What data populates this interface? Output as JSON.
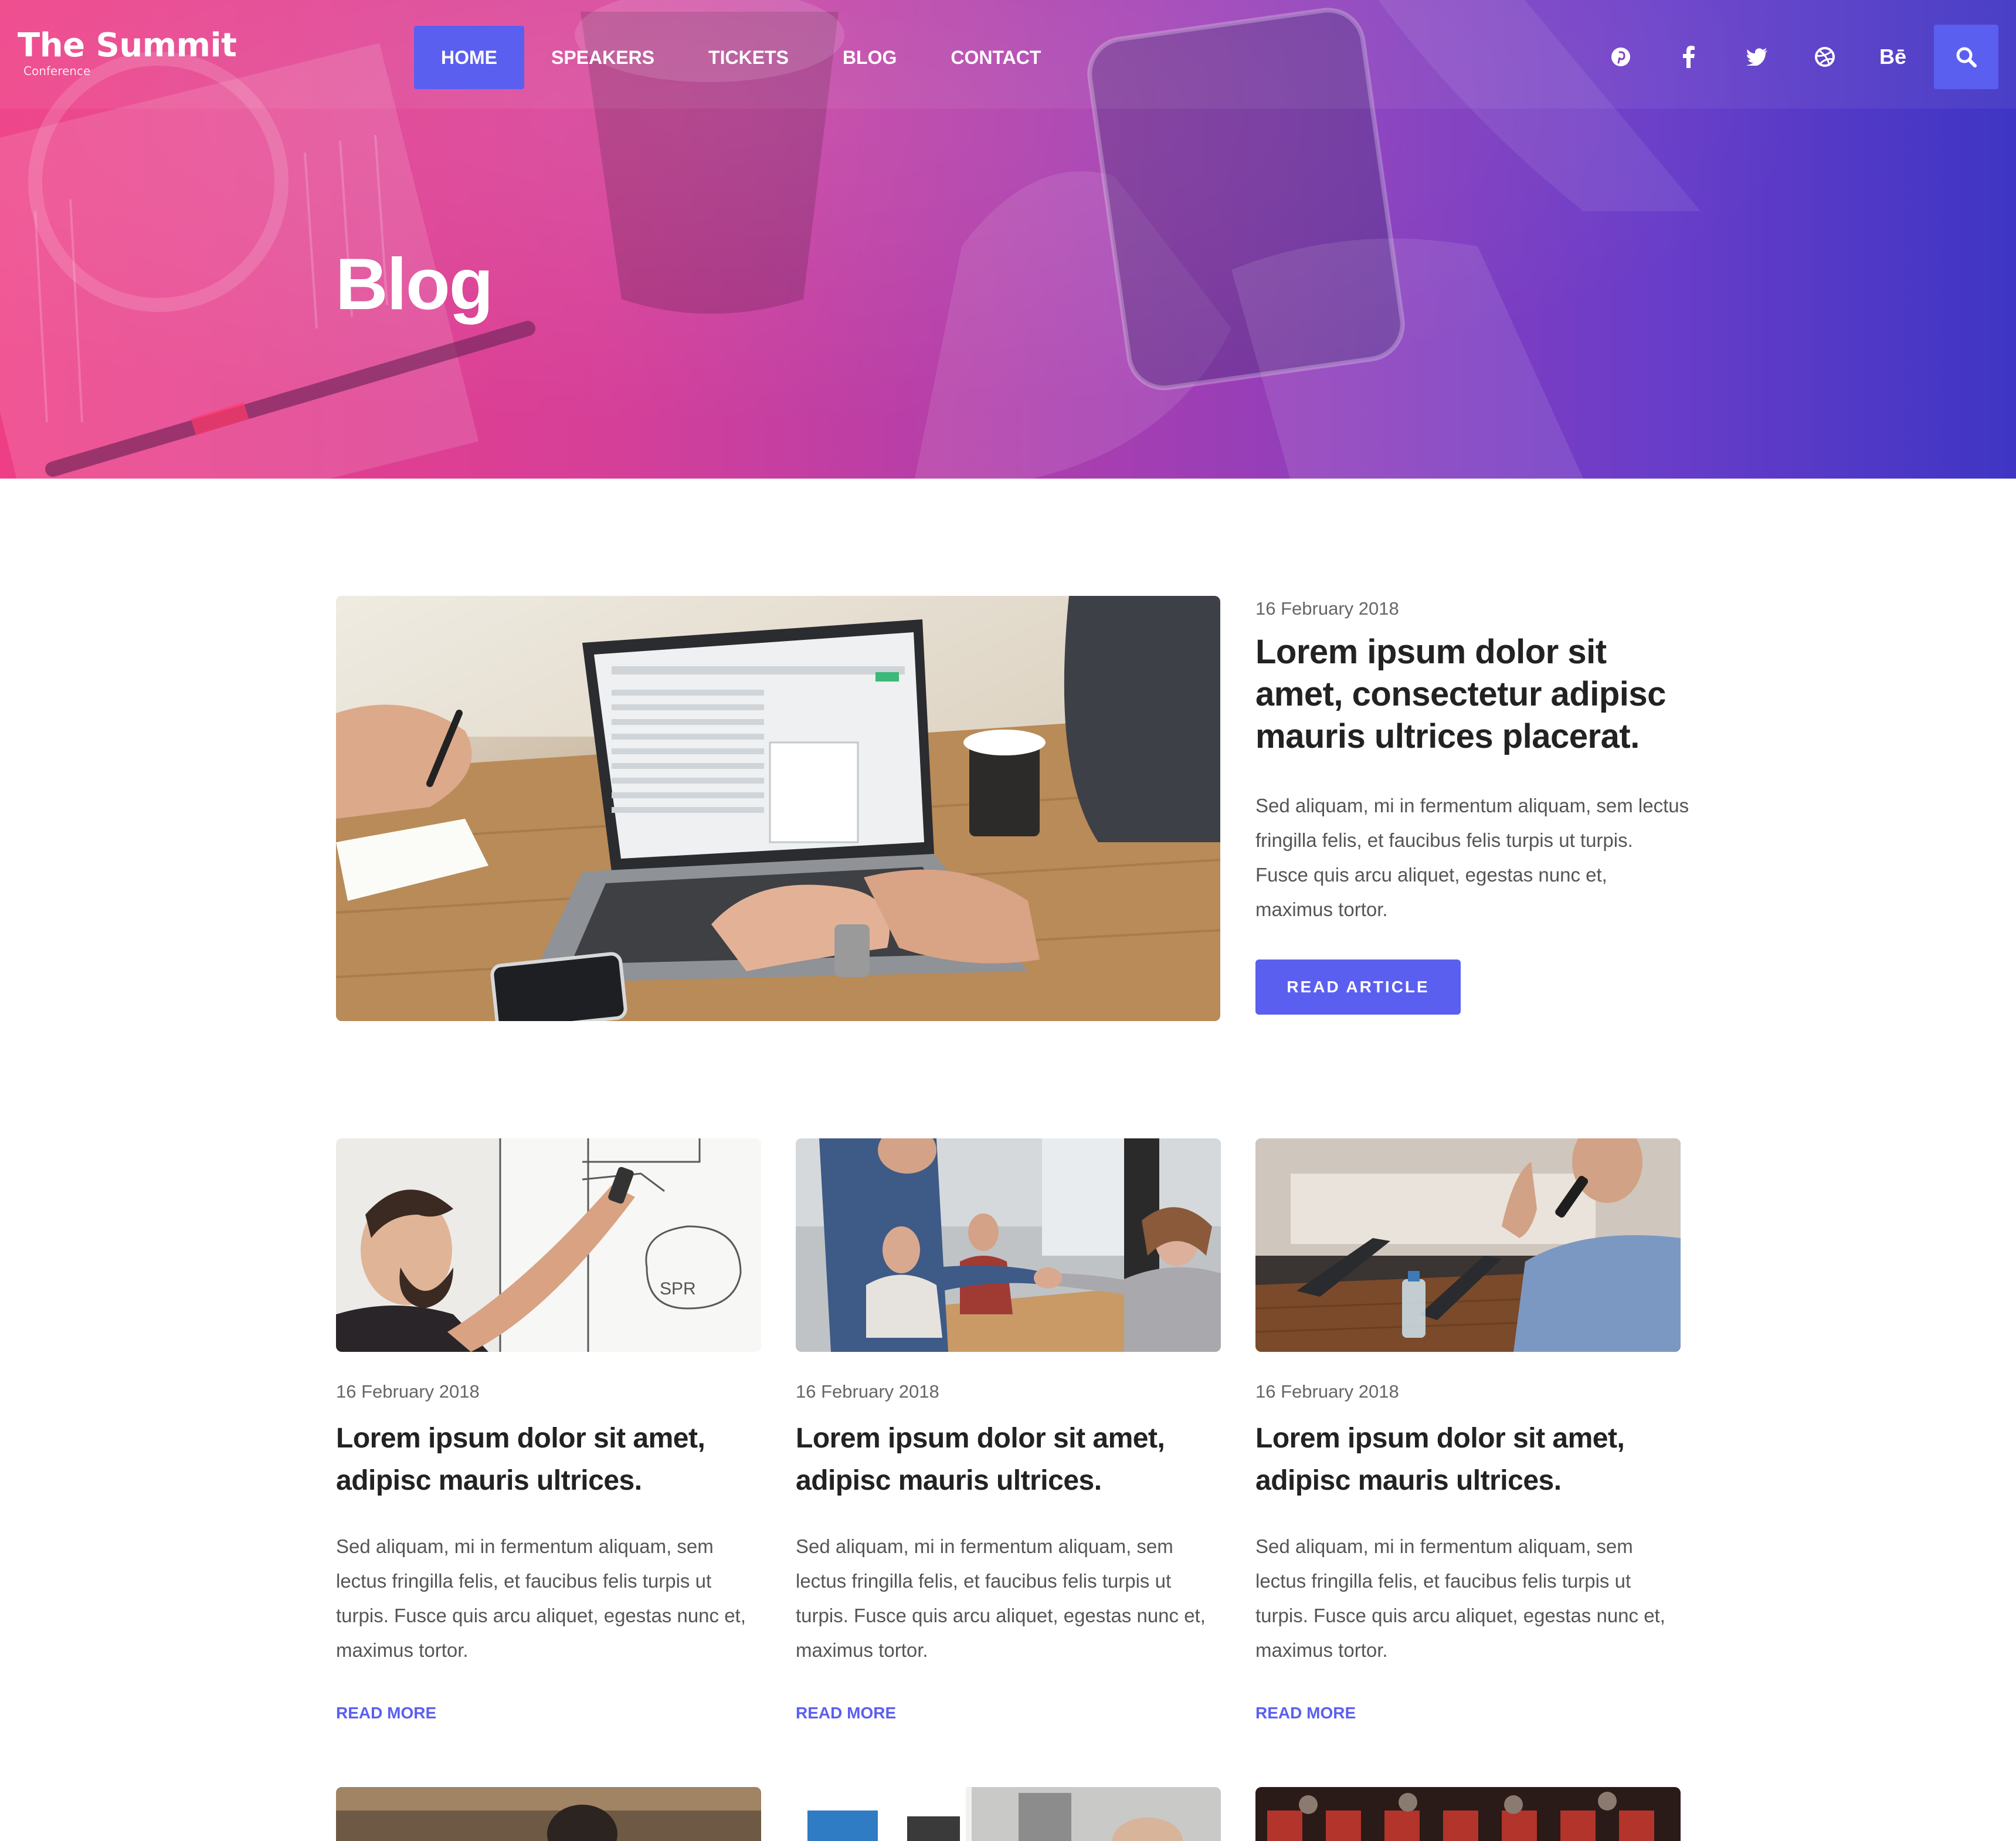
{
  "brand": {
    "title": "The Summit",
    "subtitle": "Conference"
  },
  "nav": {
    "items": [
      {
        "label": "HOME",
        "active": true
      },
      {
        "label": "SPEAKERS",
        "active": false
      },
      {
        "label": "TICKETS",
        "active": false
      },
      {
        "label": "BLOG",
        "active": false
      },
      {
        "label": "CONTACT",
        "active": false
      }
    ]
  },
  "social": {
    "icons": [
      "pinterest-icon",
      "facebook-icon",
      "twitter-icon",
      "dribbble-icon",
      "behance-icon"
    ],
    "behance_text": "Bē"
  },
  "search": {
    "icon": "search-icon"
  },
  "hero": {
    "title": "Blog"
  },
  "featured": {
    "date": "16 February 2018",
    "title": "Lorem ipsum dolor sit amet, consectetur adipisc mauris ultrices placerat.",
    "excerpt": "Sed aliquam, mi in fermentum aliquam, sem lectus fringilla felis, et faucibus felis turpis ut turpis. Fusce quis arcu aliquet, egestas nunc et, maximus tortor.",
    "button": "READ ARTICLE"
  },
  "posts": [
    {
      "date": "16 February 2018",
      "title": "Lorem ipsum dolor sit amet, adipisc mauris ultrices.",
      "excerpt": "Sed aliquam, mi in fermentum aliquam, sem lectus fringilla felis, et faucibus felis turpis ut turpis. Fusce quis arcu aliquet, egestas nunc et, maximus tortor.",
      "link": "READ MORE"
    },
    {
      "date": "16 February 2018",
      "title": "Lorem ipsum dolor sit amet, adipisc mauris ultrices.",
      "excerpt": "Sed aliquam, mi in fermentum aliquam, sem lectus fringilla felis, et faucibus felis turpis ut turpis. Fusce quis arcu aliquet, egestas nunc et, maximus tortor.",
      "link": "READ MORE"
    },
    {
      "date": "16 February 2018",
      "title": "Lorem ipsum dolor sit amet, adipisc mauris ultrices.",
      "excerpt": "Sed aliquam, mi in fermentum aliquam, sem lectus fringilla felis, et faucibus felis turpis ut turpis. Fusce quis arcu aliquet, egestas nunc et, maximus tortor.",
      "link": "READ MORE"
    }
  ],
  "colors": {
    "accent": "#5b5ff0",
    "hero_gradient_start": "#ee3f86",
    "hero_gradient_end": "#3e35c4",
    "title": "#222222",
    "body_text": "#555555"
  }
}
